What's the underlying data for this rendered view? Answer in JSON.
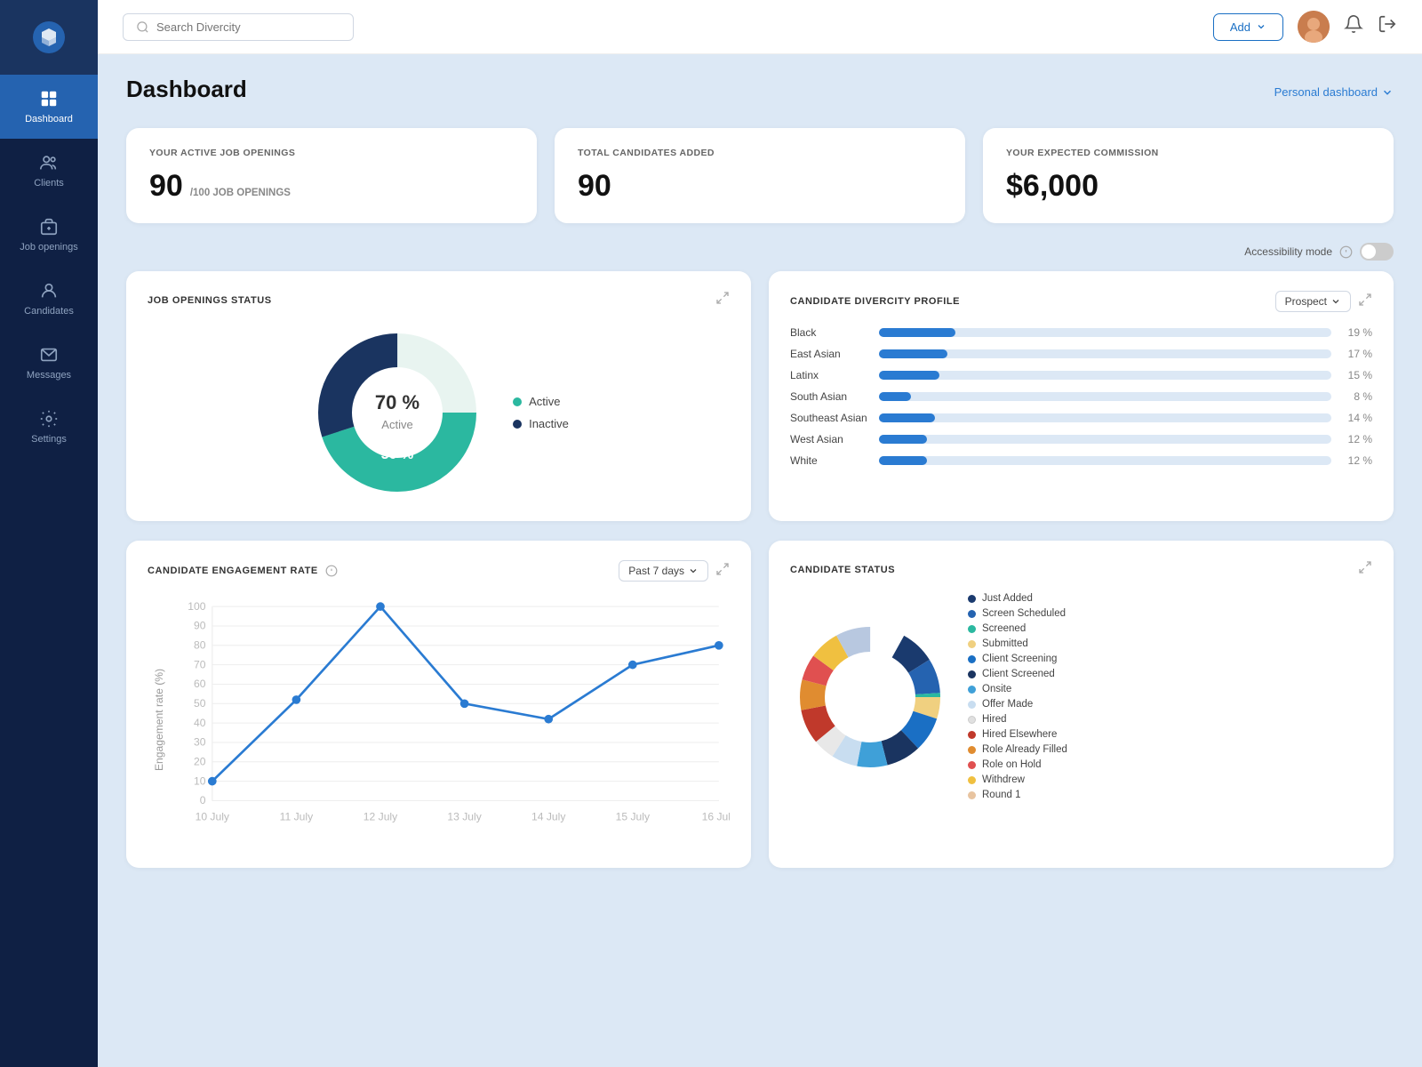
{
  "sidebar": {
    "items": [
      {
        "label": "Dashboard",
        "icon": "dashboard",
        "active": true
      },
      {
        "label": "Clients",
        "icon": "clients",
        "active": false
      },
      {
        "label": "Job openings",
        "icon": "job-openings",
        "active": false
      },
      {
        "label": "Candidates",
        "icon": "candidates",
        "active": false
      },
      {
        "label": "Messages",
        "icon": "messages",
        "active": false
      },
      {
        "label": "Settings",
        "icon": "settings",
        "active": false
      }
    ]
  },
  "topbar": {
    "search_placeholder": "Search Divercity",
    "add_label": "Add",
    "personal_dashboard_label": "Personal dashboard"
  },
  "stats": [
    {
      "label": "YOUR ACTIVE JOB OPENINGS",
      "value": "90",
      "sub": "/100 JOB OPENINGS"
    },
    {
      "label": "TOTAL CANDIDATES ADDED",
      "value": "90",
      "sub": ""
    },
    {
      "label": "YOUR EXPECTED COMMISSION",
      "value": "$6,000",
      "sub": ""
    }
  ],
  "accessibility": {
    "label": "Accessibility mode"
  },
  "job_openings_status": {
    "title": "JOB OPENINGS STATUS",
    "active_pct": 70,
    "inactive_pct": 30,
    "active_label": "Active",
    "inactive_label": "Inactive"
  },
  "diversity_profile": {
    "title": "CANDIDATE DIVERCITY PROFILE",
    "dropdown_label": "Prospect",
    "bars": [
      {
        "label": "Black",
        "pct": 19
      },
      {
        "label": "East Asian",
        "pct": 17
      },
      {
        "label": "Latinx",
        "pct": 15
      },
      {
        "label": "South Asian",
        "pct": 8
      },
      {
        "label": "Southeast Asian",
        "pct": 14
      },
      {
        "label": "West Asian",
        "pct": 12
      },
      {
        "label": "White",
        "pct": 12
      }
    ]
  },
  "engagement": {
    "title": "CANDIDATE ENGAGEMENT RATE",
    "dropdown_label": "Past 7 days",
    "y_label": "Engagement rate (%)",
    "x_labels": [
      "10 July",
      "11 July",
      "12 July",
      "13 July",
      "14 July",
      "15 July",
      "16 July"
    ],
    "y_ticks": [
      0,
      10,
      20,
      30,
      40,
      50,
      60,
      70,
      80,
      90,
      100
    ],
    "data_points": [
      10,
      52,
      100,
      50,
      42,
      70,
      80
    ]
  },
  "candidate_status": {
    "title": "CANDIDATE STATUS",
    "legend": [
      {
        "label": "Just Added",
        "color": "#1a3a6e"
      },
      {
        "label": "Screen Scheduled",
        "color": "#2563b0"
      },
      {
        "label": "Screened",
        "color": "#2bb8a0"
      },
      {
        "label": "Submitted",
        "color": "#f0d080"
      },
      {
        "label": "Client Screening",
        "color": "#1a6fc4"
      },
      {
        "label": "Client Screened",
        "color": "#1a3460"
      },
      {
        "label": "Onsite",
        "color": "#3fa0d8"
      },
      {
        "label": "Offer Made",
        "color": "#c8ddf0"
      },
      {
        "label": "Hired",
        "color": "#fff"
      },
      {
        "label": "Hired Elsewhere",
        "color": "#c0392b"
      },
      {
        "label": "Role Already Filled",
        "color": "#e08c30"
      },
      {
        "label": "Role on Hold",
        "color": "#e05050"
      },
      {
        "label": "Withdrew",
        "color": "#f0c040"
      },
      {
        "label": "Round 1",
        "color": "#e8c4a0"
      }
    ],
    "donut_segments": [
      {
        "color": "#1a3a6e",
        "pct": 8
      },
      {
        "color": "#2563b0",
        "pct": 8
      },
      {
        "color": "#2bb8a0",
        "pct": 8
      },
      {
        "color": "#f0d080",
        "pct": 6
      },
      {
        "color": "#1a6fc4",
        "pct": 8
      },
      {
        "color": "#1a3460",
        "pct": 8
      },
      {
        "color": "#3fa0d8",
        "pct": 7
      },
      {
        "color": "#c8ddf0",
        "pct": 6
      },
      {
        "color": "#e8e8e8",
        "pct": 5
      },
      {
        "color": "#c0392b",
        "pct": 8
      },
      {
        "color": "#e08c30",
        "pct": 7
      },
      {
        "color": "#e05050",
        "pct": 6
      },
      {
        "color": "#f0c040",
        "pct": 7
      },
      {
        "color": "#b8c8e0",
        "pct": 8
      }
    ]
  }
}
